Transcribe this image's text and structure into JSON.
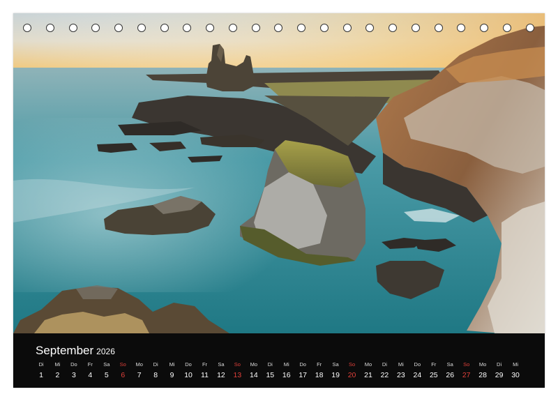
{
  "calendar": {
    "month": "September",
    "year": "2026",
    "days": [
      {
        "wd": "Di",
        "num": "1"
      },
      {
        "wd": "Mi",
        "num": "2"
      },
      {
        "wd": "Do",
        "num": "3"
      },
      {
        "wd": "Fr",
        "num": "4"
      },
      {
        "wd": "Sa",
        "num": "5"
      },
      {
        "wd": "So",
        "num": "6",
        "sunday": true
      },
      {
        "wd": "Mo",
        "num": "7"
      },
      {
        "wd": "Di",
        "num": "8"
      },
      {
        "wd": "Mi",
        "num": "9"
      },
      {
        "wd": "Do",
        "num": "10"
      },
      {
        "wd": "Fr",
        "num": "11"
      },
      {
        "wd": "Sa",
        "num": "12"
      },
      {
        "wd": "So",
        "num": "13",
        "sunday": true
      },
      {
        "wd": "Mo",
        "num": "14"
      },
      {
        "wd": "Di",
        "num": "15"
      },
      {
        "wd": "Mi",
        "num": "16"
      },
      {
        "wd": "Do",
        "num": "17"
      },
      {
        "wd": "Fr",
        "num": "18"
      },
      {
        "wd": "Sa",
        "num": "19"
      },
      {
        "wd": "So",
        "num": "20",
        "sunday": true
      },
      {
        "wd": "Mo",
        "num": "21"
      },
      {
        "wd": "Di",
        "num": "22"
      },
      {
        "wd": "Mi",
        "num": "23"
      },
      {
        "wd": "Do",
        "num": "24"
      },
      {
        "wd": "Fr",
        "num": "25"
      },
      {
        "wd": "Sa",
        "num": "26"
      },
      {
        "wd": "So",
        "num": "27",
        "sunday": true
      },
      {
        "wd": "Mo",
        "num": "28"
      },
      {
        "wd": "Di",
        "num": "29"
      },
      {
        "wd": "Mi",
        "num": "30"
      }
    ]
  },
  "colors": {
    "sunday": "#e0403a",
    "calendar_bar": "#0b0b0b",
    "sea": "#2f8d99",
    "sky": "#e9d9b6"
  },
  "binding_rings": 23
}
